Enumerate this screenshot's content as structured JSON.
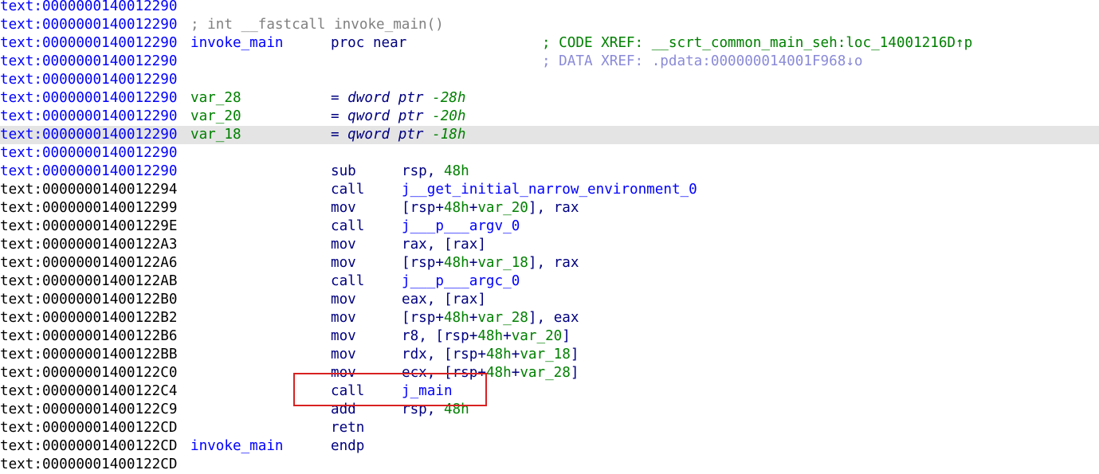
{
  "listing": [
    {
      "addr": "text:0000000140012290",
      "addr_style": "func"
    },
    {
      "addr": "text:0000000140012290",
      "addr_style": "func",
      "comment": "; int __fastcall invoke_main()"
    },
    {
      "addr": "text:0000000140012290",
      "addr_style": "func",
      "label": "invoke_main",
      "mnemonic": "proc near",
      "xref": "; CODE XREF: __scrt_common_main_seh:loc_14001216D↑p",
      "xref_kind": "code"
    },
    {
      "addr": "text:0000000140012290",
      "addr_style": "func",
      "xref": "; DATA XREF: .pdata:000000014001F968↓o",
      "xref_kind": "data"
    },
    {
      "addr": "text:0000000140012290",
      "addr_style": "func"
    },
    {
      "addr": "text:0000000140012290",
      "addr_style": "func",
      "label": "var_28",
      "label_kind": "var",
      "mnemonic": "= dword ptr -28h"
    },
    {
      "addr": "text:0000000140012290",
      "addr_style": "func",
      "label": "var_20",
      "label_kind": "var",
      "mnemonic": "= qword ptr -20h"
    },
    {
      "addr": "text:0000000140012290",
      "addr_style": "func",
      "label": "var_18",
      "label_kind": "var",
      "mnemonic": "= qword ptr -18h",
      "highlighted": true
    },
    {
      "addr": "text:0000000140012290",
      "addr_style": "func"
    },
    {
      "addr": "text:0000000140012290",
      "addr_style": "func",
      "mnemonic": "sub",
      "operands": "rsp, 48h"
    },
    {
      "addr": "text:0000000140012294",
      "addr_style": "plain",
      "mnemonic": "call",
      "operands": "j__get_initial_narrow_environment_0"
    },
    {
      "addr": "text:0000000140012299",
      "addr_style": "plain",
      "mnemonic": "mov",
      "operands": "[rsp+48h+var_20], rax"
    },
    {
      "addr": "text:000000014001229E",
      "addr_style": "plain",
      "mnemonic": "call",
      "operands": "j___p___argv_0"
    },
    {
      "addr": "text:00000001400122A3",
      "addr_style": "plain",
      "mnemonic": "mov",
      "operands": "rax, [rax]"
    },
    {
      "addr": "text:00000001400122A6",
      "addr_style": "plain",
      "mnemonic": "mov",
      "operands": "[rsp+48h+var_18], rax"
    },
    {
      "addr": "text:00000001400122AB",
      "addr_style": "plain",
      "mnemonic": "call",
      "operands": "j___p___argc_0"
    },
    {
      "addr": "text:00000001400122B0",
      "addr_style": "plain",
      "mnemonic": "mov",
      "operands": "eax, [rax]"
    },
    {
      "addr": "text:00000001400122B2",
      "addr_style": "plain",
      "mnemonic": "mov",
      "operands": "[rsp+48h+var_28], eax"
    },
    {
      "addr": "text:00000001400122B6",
      "addr_style": "plain",
      "mnemonic": "mov",
      "operands": "r8, [rsp+48h+var_20]"
    },
    {
      "addr": "text:00000001400122BB",
      "addr_style": "plain",
      "mnemonic": "mov",
      "operands": "rdx, [rsp+48h+var_18]"
    },
    {
      "addr": "text:00000001400122C0",
      "addr_style": "plain",
      "mnemonic": "mov",
      "operands": "ecx, [rsp+48h+var_28]"
    },
    {
      "addr": "text:00000001400122C4",
      "addr_style": "plain",
      "mnemonic": "call",
      "operands": "j_main"
    },
    {
      "addr": "text:00000001400122C9",
      "addr_style": "plain",
      "mnemonic": "add",
      "operands": "rsp, 48h"
    },
    {
      "addr": "text:00000001400122CD",
      "addr_style": "plain",
      "mnemonic": "retn"
    },
    {
      "addr": "text:00000001400122CD",
      "addr_style": "plain",
      "label": "invoke_main",
      "mnemonic": "endp"
    },
    {
      "addr": "text:00000001400122CD",
      "addr_style": "plain"
    }
  ],
  "colors": {
    "address_function": "#0000ff",
    "address_plain": "#000000",
    "instruction": "#000080",
    "number_and_variable": "#008000",
    "comment": "#808080",
    "data_xref": "#8a8ad8",
    "current_line_highlight": "#e4e4e4",
    "annotation_box": "#d92121"
  },
  "annotation": {
    "target": "call j_main"
  }
}
